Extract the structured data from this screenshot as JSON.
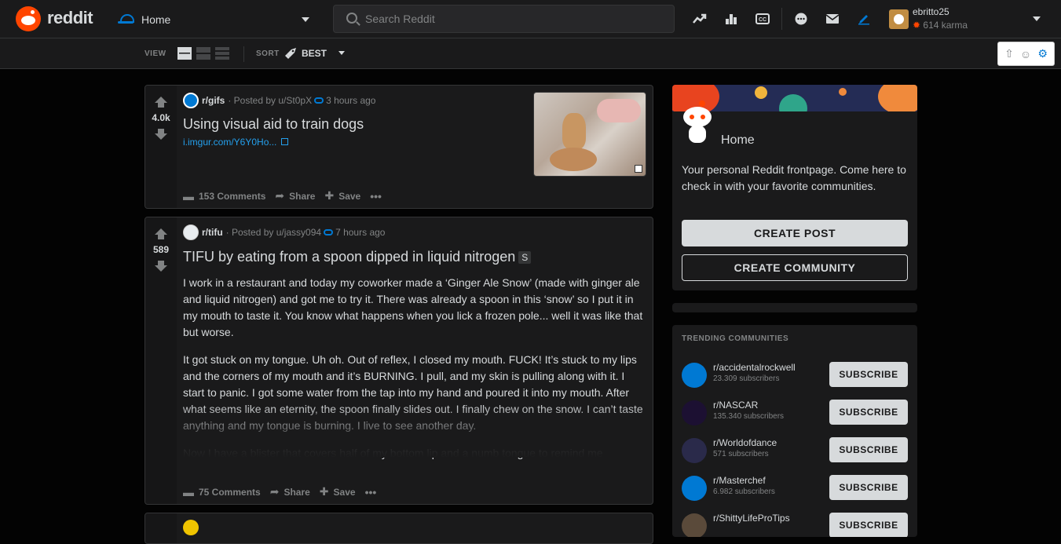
{
  "header": {
    "wordmark": "reddit",
    "feed_label": "Home",
    "search_placeholder": "Search Reddit",
    "icons": [
      "trending-icon",
      "stats-icon",
      "captions-icon",
      "chat-icon",
      "mail-icon",
      "pencil-icon"
    ],
    "user": {
      "name": "ebritto25",
      "karma": "614 karma"
    }
  },
  "subbar": {
    "view_label": "VIEW",
    "sort_label": "SORT",
    "sort_value": "BEST"
  },
  "posts": [
    {
      "score": "4.0k",
      "subreddit": "r/gifs",
      "posted_by": "· Posted by u/St0pX",
      "time": "3 hours ago",
      "title": "Using visual aid to train dogs",
      "link_text": "i.imgur.com/Y6Y0Ho...",
      "comments": "153 Comments",
      "share": "Share",
      "save": "Save"
    },
    {
      "score": "589",
      "subreddit": "r/tifu",
      "posted_by": "· Posted by u/jassy094",
      "time": "7 hours ago",
      "title": "TIFU by eating from a spoon dipped in liquid nitrogen",
      "flair": "S",
      "body": [
        "I work in a restaurant and today my coworker made a ‘Ginger Ale Snow’ (made with ginger ale and liquid nitrogen) and got me to try it. There was already a spoon in this ‘snow’ so I put it in my mouth to taste it. You know what happens when you lick a frozen pole... well it was like that but worse.",
        "It got stuck on my tongue. Uh oh. Out of reflex, I closed my mouth. FUCK! It’s stuck to my lips and the corners of my mouth and it’s BURNING. I pull, and my skin is pulling along with it. I start to panic. I got some water from the tap into my hand and poured it into my mouth. After what seems like an eternity, the spoon finally slides out. I finally chew on the snow. I can’t taste anything and my tongue is burning. I live to see another day.",
        "Now I have a blister that covers half of my bottom lip and a numb tongue to remind me"
      ],
      "comments": "75 Comments",
      "share": "Share",
      "save": "Save"
    }
  ],
  "sidebar": {
    "home": {
      "title": "Home",
      "description": "Your personal Reddit frontpage. Come here to check in with your favorite communities.",
      "create_post": "CREATE POST",
      "create_community": "CREATE COMMUNITY"
    },
    "trending": {
      "heading": "TRENDING COMMUNITIES",
      "button_label": "SUBSCRIBE",
      "items": [
        {
          "name": "r/accidentalrockwell",
          "subscribers": "23.309 subscribers",
          "color": "#0079d3"
        },
        {
          "name": "r/NASCAR",
          "subscribers": "135.340 subscribers",
          "color": "#1c1032"
        },
        {
          "name": "r/Worldofdance",
          "subscribers": "571 subscribers",
          "color": "#2a2a4a"
        },
        {
          "name": "r/Masterchef",
          "subscribers": "6.982 subscribers",
          "color": "#0079d3"
        },
        {
          "name": "r/ShittyLifeProTips",
          "subscribers": "",
          "color": "#5a4a3a"
        }
      ]
    }
  },
  "colors": {
    "accent": "#0079d3",
    "brand": "#ff4500",
    "background": "#030303",
    "card": "#1a1a1b"
  }
}
